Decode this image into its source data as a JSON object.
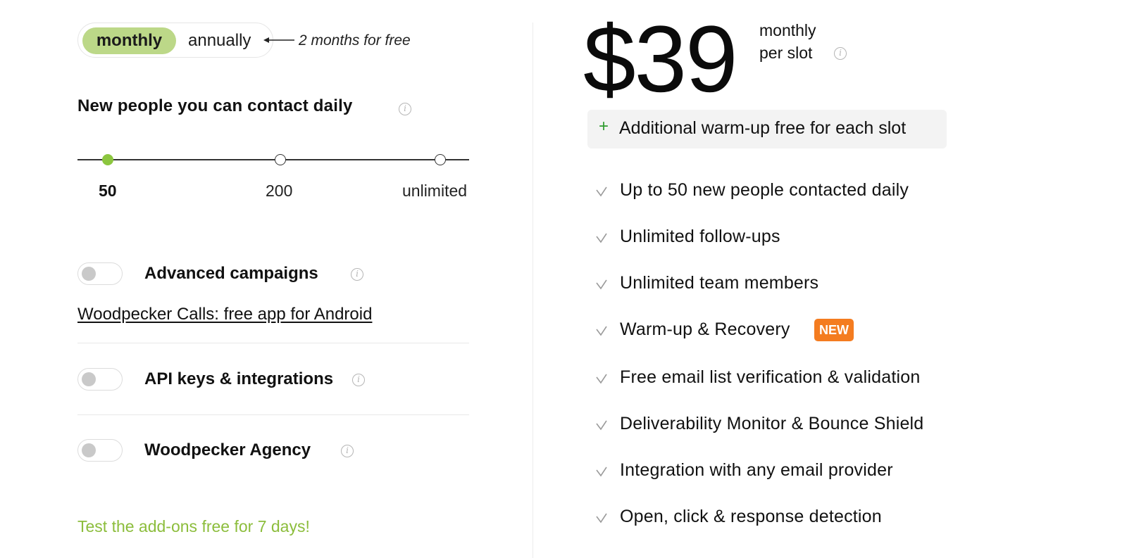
{
  "billing": {
    "monthly_label": "monthly",
    "annually_label": "annually",
    "promo": "2 months for free",
    "selected": "monthly"
  },
  "contacts": {
    "heading": "New people you can contact daily",
    "options": [
      "50",
      "200",
      "unlimited"
    ],
    "selected": "50"
  },
  "addons": {
    "advanced_campaigns": "Advanced campaigns",
    "calls_link": "Woodpecker Calls: free app for Android",
    "api_keys": "API keys & integrations",
    "agency": "Woodpecker Agency",
    "trial_note": "Test the add-ons free for 7 days!"
  },
  "pricing": {
    "price": "$39",
    "unit_line1": "monthly",
    "unit_line2": "per slot",
    "extra_plus": "+",
    "extra": "Additional warm-up free for each slot"
  },
  "features": [
    "Up to 50 new people contacted daily",
    "Unlimited follow-ups",
    "Unlimited team members",
    "Warm-up & Recovery",
    "Free email list verification & validation",
    "Deliverability Monitor & Bounce Shield",
    "Integration with any email provider",
    "Open, click & response detection"
  ],
  "badges": {
    "new": "NEW"
  },
  "icons": {
    "info": "i"
  },
  "colors": {
    "accent_green": "#bcd888",
    "slider_green": "#8cc63f",
    "trial_green": "#8cbd3c",
    "badge_orange": "#f47c20"
  }
}
